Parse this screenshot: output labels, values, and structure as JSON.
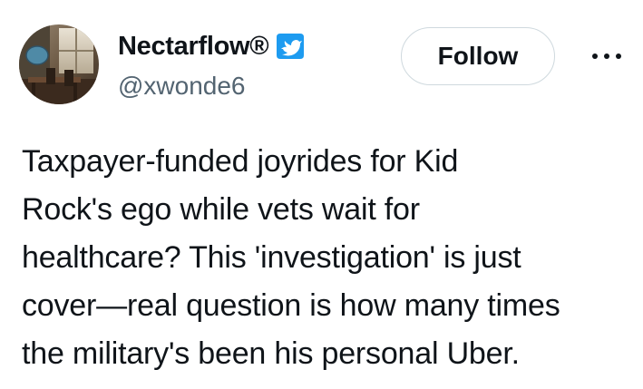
{
  "author": {
    "display_name": "Nectarflow®",
    "handle": "@xwonde6",
    "verified_icon": "verified-badge-icon"
  },
  "actions": {
    "follow_label": "Follow",
    "more_icon": "more-options-icon"
  },
  "tweet": {
    "lines": [
      "Taxpayer-funded joyrides for Kid",
      "Rock's ego while vets wait for",
      "healthcare? This 'investigation' is just",
      "cover—real question is how many times",
      "the military's been his personal Uber."
    ]
  },
  "colors": {
    "text": "#0f1419",
    "secondary_text": "#536471",
    "verified_blue": "#1d9bf0",
    "button_border": "#cfd9de",
    "background": "#ffffff"
  }
}
